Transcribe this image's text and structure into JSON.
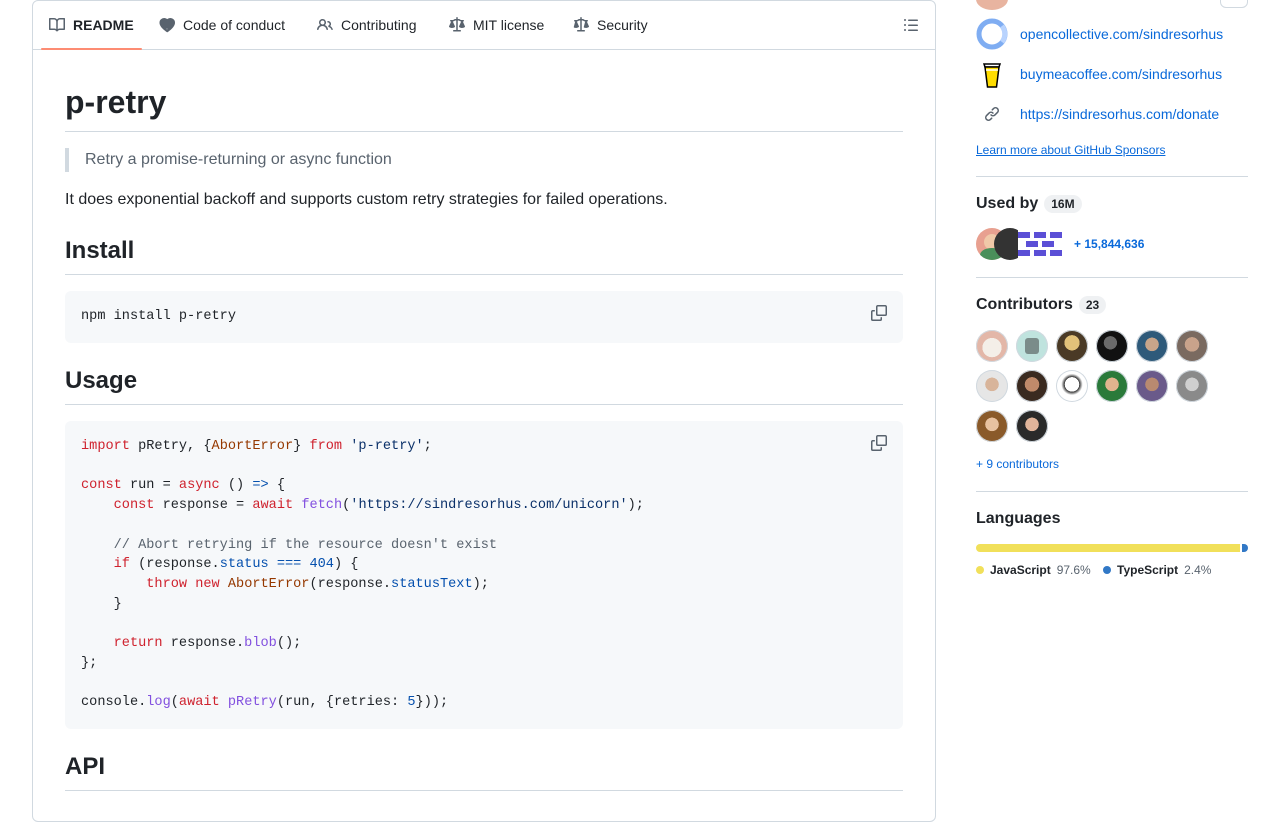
{
  "tabs": [
    {
      "label": "README",
      "icon": "book-icon"
    },
    {
      "label": "Code of conduct",
      "icon": "code-of-conduct-icon"
    },
    {
      "label": "Contributing",
      "icon": "people-icon"
    },
    {
      "label": "MIT license",
      "icon": "law-icon"
    },
    {
      "label": "Security",
      "icon": "law-icon"
    }
  ],
  "readme": {
    "title": "p-retry",
    "tagline": "Retry a promise-returning or async function",
    "description": "It does exponential backoff and supports custom retry strategies for failed operations.",
    "install_heading": "Install",
    "install_code": "npm install p-retry",
    "usage_heading": "Usage",
    "usage_code": [
      "import pRetry, {AbortError} from 'p-retry';",
      "",
      "const run = async () => {",
      "    const response = await fetch('https://sindresorhus.com/unicorn');",
      "",
      "    // Abort retrying if the resource doesn't exist",
      "    if (response.status === 404) {",
      "        throw new AbortError(response.statusText);",
      "    }",
      "",
      "    return response.blob();",
      "};",
      "",
      "console.log(await pRetry(run, {retries: 5}));"
    ],
    "api_heading": "API"
  },
  "sponsors": {
    "links": [
      {
        "text": "opencollective.com/sindresorhus",
        "icon": "opencollective-icon"
      },
      {
        "text": "buymeacoffee.com/sindresorhus",
        "icon": "buymeacoffee-icon"
      },
      {
        "text": "https://sindresorhus.com/donate",
        "icon": "link-icon"
      }
    ],
    "learn_more": "Learn more about GitHub Sponsors"
  },
  "used_by": {
    "heading": "Used by",
    "count": "16M",
    "more": "+ 15,844,636"
  },
  "contributors": {
    "heading": "Contributors",
    "count": "23",
    "more": "+ 9 contributors"
  },
  "languages": {
    "heading": "Languages",
    "items": [
      {
        "name": "JavaScript",
        "percent": "97.6%",
        "value": 97.6,
        "color": "#f1e05a"
      },
      {
        "name": "TypeScript",
        "percent": "2.4%",
        "value": 2.4,
        "color": "#3178c6"
      }
    ]
  }
}
